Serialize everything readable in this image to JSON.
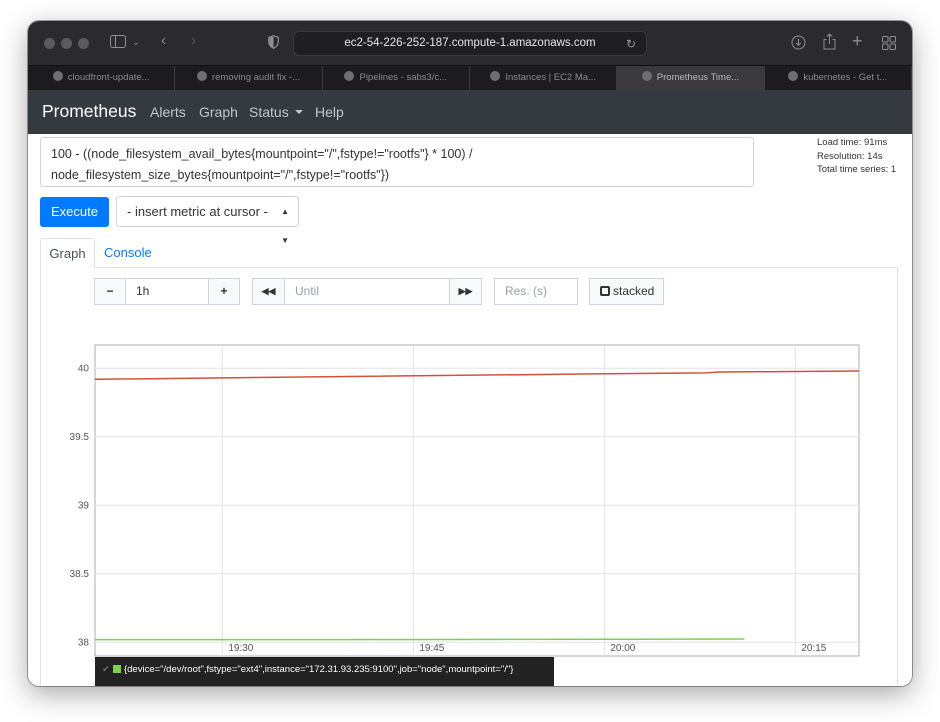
{
  "browser": {
    "url": "ec2-54-226-252-187.compute-1.amazonaws.com",
    "tabs": [
      {
        "label": "cloudfront-update...",
        "active": false
      },
      {
        "label": "removing audit fix -...",
        "active": false
      },
      {
        "label": "Pipelines - sabs3/c...",
        "active": false
      },
      {
        "label": "Instances | EC2 Ma...",
        "active": false
      },
      {
        "label": "Prometheus Time...",
        "active": true
      },
      {
        "label": "kubernetes - Get t...",
        "active": false
      }
    ]
  },
  "nav": {
    "brand": "Prometheus",
    "alerts": "Alerts",
    "graph": "Graph",
    "status": "Status",
    "help": "Help"
  },
  "query": {
    "expression": "100 - ((node_filesystem_avail_bytes{mountpoint=\"/\",fstype!=\"rootfs\"} * 100) /\nnode_filesystem_size_bytes{mountpoint=\"/\",fstype!=\"rootfs\"})",
    "load_time": "Load time: 91ms",
    "resolution": "Resolution: 14s",
    "total_series": "Total time series: 1",
    "execute_label": "Execute",
    "metric_select": "- insert metric at cursor -"
  },
  "tabs": {
    "graph": "Graph",
    "console": "Console"
  },
  "controls": {
    "minus": "−",
    "range": "1h",
    "plus": "+",
    "back": "◀◀",
    "until_placeholder": "Until",
    "forward": "▶▶",
    "res_placeholder": "Res. (s)",
    "stacked": "stacked"
  },
  "legend": {
    "label": "{device=\"/dev/root\",fstype=\"ext4\",instance=\"172.31.93.235:9100\",job=\"node\",mountpoint=\"/\"}",
    "color": "#7ed14b"
  },
  "chart_data": {
    "type": "line",
    "title": "",
    "xlabel": "",
    "ylabel": "",
    "ylim": [
      37.9,
      40.17
    ],
    "x_ticks": [
      "19:30",
      "19:45",
      "20:00",
      "20:15"
    ],
    "y_ticks": [
      "38",
      "38.5",
      "39",
      "39.5",
      "40"
    ],
    "grid": true,
    "series": [
      {
        "color": "#d1523a",
        "x": [
          "19:20",
          "19:40",
          "20:00",
          "20:08",
          "20:09",
          "20:20"
        ],
        "y": [
          39.92,
          39.94,
          39.96,
          39.966,
          39.973,
          39.98
        ]
      },
      {
        "color": "#7ed14b",
        "x": [
          "19:20",
          "19:40",
          "20:00",
          "20:11"
        ],
        "y": [
          38.02,
          38.02,
          38.022,
          38.024
        ]
      }
    ]
  }
}
